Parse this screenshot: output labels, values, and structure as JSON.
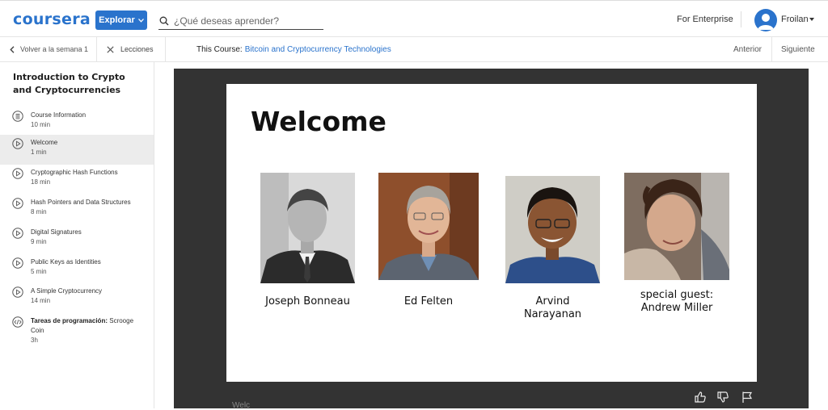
{
  "header": {
    "logo_text": "coursera",
    "explore_label": "Explorar",
    "search_placeholder": "¿Qué deseas aprender?",
    "enterprise_label": "For Enterprise",
    "username": "Froilan"
  },
  "subnav": {
    "back_label": "Volver a la semana 1",
    "lessons_label": "Lecciones",
    "course_prefix": "This Course:",
    "course_name": "Bitcoin and Cryptocurrency Technologies",
    "prev_label": "Anterior",
    "next_label": "Siguiente"
  },
  "sidebar": {
    "title": "Introduction to Crypto and Cryptocurrencies",
    "items": [
      {
        "label": "Course Information",
        "duration": "10 min",
        "icon": "reading-icon"
      },
      {
        "label": "Welcome",
        "duration": "1 min",
        "icon": "play-icon"
      },
      {
        "label": "Cryptographic Hash Functions",
        "duration": "18 min",
        "icon": "play-icon"
      },
      {
        "label": "Hash Pointers and Data Structures",
        "duration": "8 min",
        "icon": "play-icon"
      },
      {
        "label": "Digital Signatures",
        "duration": "9 min",
        "icon": "play-icon"
      },
      {
        "label": "Public Keys as Identities",
        "duration": "5 min",
        "icon": "play-icon"
      },
      {
        "label": "A Simple Cryptocurrency",
        "duration": "14 min",
        "icon": "play-icon"
      },
      {
        "label_bold": "Tareas de programación:",
        "label": "Scrooge Coin",
        "duration": "3h",
        "icon": "code-icon"
      }
    ]
  },
  "slide": {
    "title": "Welcome",
    "people": [
      {
        "name": "Joseph Bonneau"
      },
      {
        "name": "Ed Felten"
      },
      {
        "name": "Arvind Narayanan"
      },
      {
        "name_line1": "special guest:",
        "name_line2": "Andrew Miller"
      }
    ]
  },
  "player": {
    "caption": "Welc"
  },
  "colors": {
    "brand": "#2a73cc",
    "player_bg": "#333333",
    "active_item_bg": "#ececec"
  }
}
